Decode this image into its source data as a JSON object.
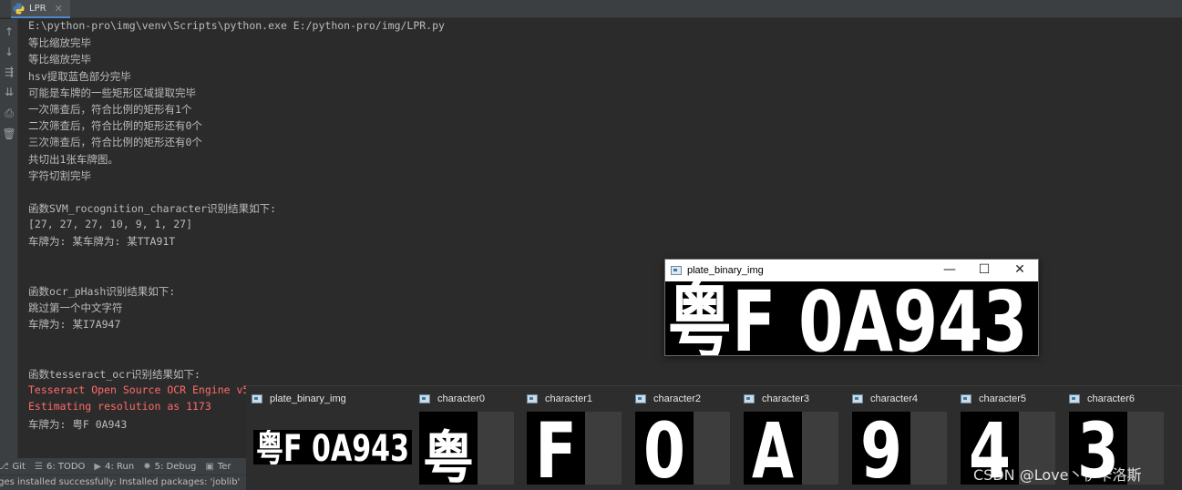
{
  "tab": {
    "label": "LPR",
    "close": "✕"
  },
  "console": {
    "lines": [
      "E:\\python-pro\\img\\venv\\Scripts\\python.exe E:/python-pro/img/LPR.py",
      "等比缩放完毕",
      "等比缩放完毕",
      "hsv提取蓝色部分完毕",
      "可能是车牌的一些矩形区域提取完毕",
      "一次筛查后，符合比例的矩形有1个",
      "二次筛查后，符合比例的矩形还有0个",
      "三次筛查后，符合比例的矩形还有0个",
      "共切出1张车牌图。",
      "字符切割完毕",
      "",
      "函数SVM_rocognition_character识别结果如下:",
      "[27, 27, 27, 10, 9, 1, 27]",
      "车牌为: 某车牌为: 某TTA91T",
      "",
      "",
      "函数ocr_pHash识别结果如下:",
      "跳过第一个中文字符",
      "车牌为: 某I7A947",
      "",
      "",
      "函数tesseract_ocr识别结果如下:",
      "Tesseract Open Source OCR Engine v5",
      "Estimating resolution as 1173",
      "车牌为: 粤F 0A943"
    ],
    "error_line_indices": [
      22,
      23
    ]
  },
  "float_window": {
    "title": "plate_binary_img",
    "plate_text": "粤F 0A943",
    "buttons": [
      "—",
      "☐",
      "✕"
    ]
  },
  "thumbnails": [
    {
      "label": "plate_binary_img",
      "glyph": "粤F 0A943"
    },
    {
      "label": "character0",
      "glyph": "粤"
    },
    {
      "label": "character1",
      "glyph": "F"
    },
    {
      "label": "character2",
      "glyph": "0"
    },
    {
      "label": "character3",
      "glyph": "A"
    },
    {
      "label": "character4",
      "glyph": "9"
    },
    {
      "label": "character5",
      "glyph": "4"
    },
    {
      "label": "character6",
      "glyph": "3"
    }
  ],
  "toolstrip": {
    "items": [
      {
        "icon": "⎇",
        "label": "Git"
      },
      {
        "icon": "☰",
        "label": "6: TODO"
      },
      {
        "icon": "▶",
        "label": "4: Run"
      },
      {
        "icon": "✹",
        "label": "5: Debug"
      },
      {
        "icon": "▣",
        "label": "Ter"
      }
    ]
  },
  "statusbar": {
    "text": "ages installed successfully: Installed packages: 'joblib'"
  },
  "watermark": "CSDN @Love丶伊卡洛斯",
  "gutter_icons": [
    "↑",
    "↓",
    "⇶",
    "⇊",
    "⎙",
    "🗑"
  ]
}
